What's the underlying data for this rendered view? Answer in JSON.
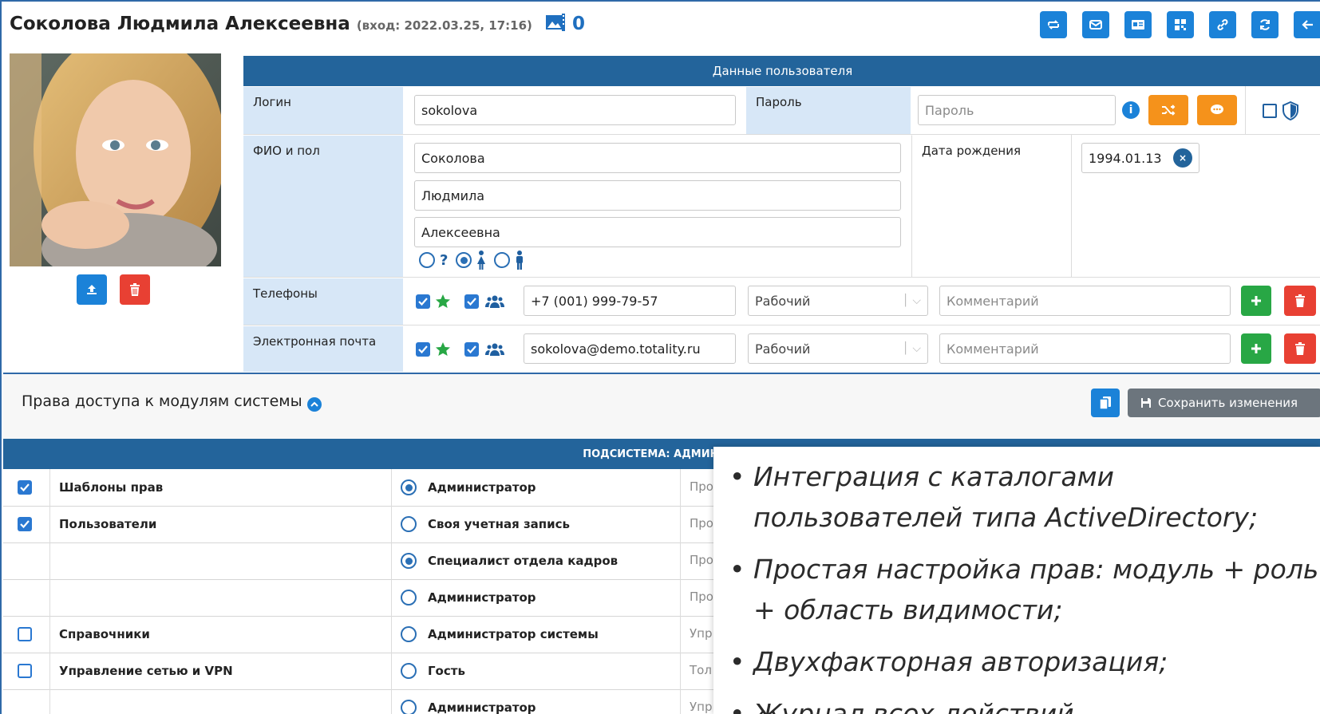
{
  "header": {
    "user_name": "Соколова Людмила Алексеевна",
    "login_info": "(вход: 2022.03.25, 17:16)",
    "photo_count": "0"
  },
  "user_data": {
    "section_title": "Данные пользователя",
    "login_label": "Логин",
    "login_value": "sokolova",
    "password_label": "Пароль",
    "password_placeholder": "Пароль",
    "fio_label": "ФИО и пол",
    "last_name": "Соколова",
    "first_name": "Людмила",
    "middle_name": "Алексеевна",
    "gender_unknown": "?",
    "birth_label": "Дата рождения",
    "birth_value": "1994.01.13",
    "phones_label": "Телефоны",
    "phone_value": "+7 (001) 999-79-57",
    "phone_type": "Рабочий",
    "phone_comment_placeholder": "Комментарий",
    "email_label": "Электронная почта",
    "email_value": "sokolova@demo.totality.ru",
    "email_type": "Рабочий",
    "email_comment_placeholder": "Комментарий"
  },
  "access": {
    "title": "Права доступа к модулям системы",
    "save_label": "Сохранить изменения",
    "subsystem_header": "ПОДСИСТЕМА: АДМИНИСТ",
    "rows": [
      {
        "module": "Шаблоны прав",
        "checked": true,
        "role": "Администратор",
        "role_selected": true,
        "desc": "Про"
      },
      {
        "module": "Пользователи",
        "checked": true,
        "role": "Своя учетная запись",
        "role_selected": false,
        "desc": "Про"
      },
      {
        "module": "",
        "checked": null,
        "role": "Специалист отдела кадров",
        "role_selected": true,
        "desc": "Про"
      },
      {
        "module": "",
        "checked": null,
        "role": "Администратор",
        "role_selected": false,
        "desc": "Про"
      },
      {
        "module": "Справочники",
        "checked": false,
        "role": "Администратор системы",
        "role_selected": false,
        "desc": "Упр"
      },
      {
        "module": "Управление сетью и VPN",
        "checked": false,
        "role": "Гость",
        "role_selected": false,
        "desc": "Тол"
      },
      {
        "module": "",
        "checked": null,
        "role": "Администратор",
        "role_selected": false,
        "desc": "Упр"
      }
    ]
  },
  "overlay_bullets": [
    "Интеграция с каталогами пользователей типа ActiveDirectory;",
    "Простая настройка прав: модуль + роль + область видимости;",
    "Двухфакторная авторизация;",
    "Журнал всех действий"
  ],
  "colors": {
    "primary": "#1b82d8",
    "header_bar": "#23649b",
    "label_bg": "#d7e7f7",
    "danger": "#e84033",
    "success": "#28a745",
    "warning": "#f5921b"
  }
}
